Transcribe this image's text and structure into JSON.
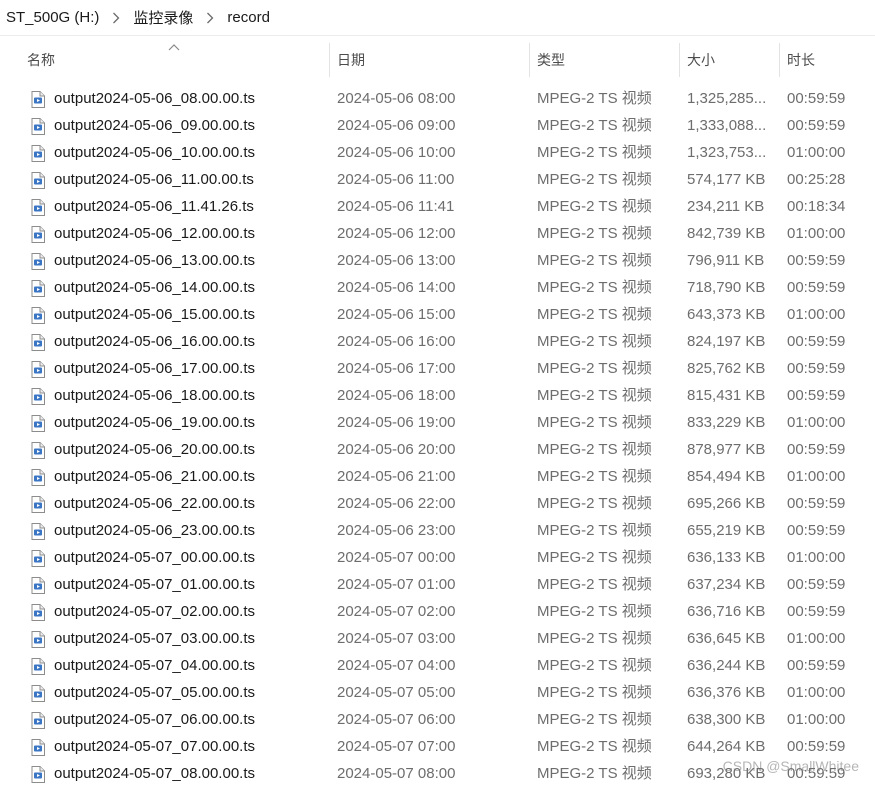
{
  "breadcrumb": [
    "ST_500G (H:)",
    "监控录像",
    "record"
  ],
  "columns": {
    "name": "名称",
    "date": "日期",
    "type": "类型",
    "size": "大小",
    "duration": "时长"
  },
  "files": [
    {
      "name": "output2024-05-06_08.00.00.ts",
      "date": "2024-05-06 08:00",
      "type": "MPEG-2 TS 视频",
      "size": "1,325,285...",
      "duration": "00:59:59"
    },
    {
      "name": "output2024-05-06_09.00.00.ts",
      "date": "2024-05-06 09:00",
      "type": "MPEG-2 TS 视频",
      "size": "1,333,088...",
      "duration": "00:59:59"
    },
    {
      "name": "output2024-05-06_10.00.00.ts",
      "date": "2024-05-06 10:00",
      "type": "MPEG-2 TS 视频",
      "size": "1,323,753...",
      "duration": "01:00:00"
    },
    {
      "name": "output2024-05-06_11.00.00.ts",
      "date": "2024-05-06 11:00",
      "type": "MPEG-2 TS 视频",
      "size": "574,177 KB",
      "duration": "00:25:28"
    },
    {
      "name": "output2024-05-06_11.41.26.ts",
      "date": "2024-05-06 11:41",
      "type": "MPEG-2 TS 视频",
      "size": "234,211 KB",
      "duration": "00:18:34"
    },
    {
      "name": "output2024-05-06_12.00.00.ts",
      "date": "2024-05-06 12:00",
      "type": "MPEG-2 TS 视频",
      "size": "842,739 KB",
      "duration": "01:00:00"
    },
    {
      "name": "output2024-05-06_13.00.00.ts",
      "date": "2024-05-06 13:00",
      "type": "MPEG-2 TS 视频",
      "size": "796,911 KB",
      "duration": "00:59:59"
    },
    {
      "name": "output2024-05-06_14.00.00.ts",
      "date": "2024-05-06 14:00",
      "type": "MPEG-2 TS 视频",
      "size": "718,790 KB",
      "duration": "00:59:59"
    },
    {
      "name": "output2024-05-06_15.00.00.ts",
      "date": "2024-05-06 15:00",
      "type": "MPEG-2 TS 视频",
      "size": "643,373 KB",
      "duration": "01:00:00"
    },
    {
      "name": "output2024-05-06_16.00.00.ts",
      "date": "2024-05-06 16:00",
      "type": "MPEG-2 TS 视频",
      "size": "824,197 KB",
      "duration": "00:59:59"
    },
    {
      "name": "output2024-05-06_17.00.00.ts",
      "date": "2024-05-06 17:00",
      "type": "MPEG-2 TS 视频",
      "size": "825,762 KB",
      "duration": "00:59:59"
    },
    {
      "name": "output2024-05-06_18.00.00.ts",
      "date": "2024-05-06 18:00",
      "type": "MPEG-2 TS 视频",
      "size": "815,431 KB",
      "duration": "00:59:59"
    },
    {
      "name": "output2024-05-06_19.00.00.ts",
      "date": "2024-05-06 19:00",
      "type": "MPEG-2 TS 视频",
      "size": "833,229 KB",
      "duration": "01:00:00"
    },
    {
      "name": "output2024-05-06_20.00.00.ts",
      "date": "2024-05-06 20:00",
      "type": "MPEG-2 TS 视频",
      "size": "878,977 KB",
      "duration": "00:59:59"
    },
    {
      "name": "output2024-05-06_21.00.00.ts",
      "date": "2024-05-06 21:00",
      "type": "MPEG-2 TS 视频",
      "size": "854,494 KB",
      "duration": "01:00:00"
    },
    {
      "name": "output2024-05-06_22.00.00.ts",
      "date": "2024-05-06 22:00",
      "type": "MPEG-2 TS 视频",
      "size": "695,266 KB",
      "duration": "00:59:59"
    },
    {
      "name": "output2024-05-06_23.00.00.ts",
      "date": "2024-05-06 23:00",
      "type": "MPEG-2 TS 视频",
      "size": "655,219 KB",
      "duration": "00:59:59"
    },
    {
      "name": "output2024-05-07_00.00.00.ts",
      "date": "2024-05-07 00:00",
      "type": "MPEG-2 TS 视频",
      "size": "636,133 KB",
      "duration": "01:00:00"
    },
    {
      "name": "output2024-05-07_01.00.00.ts",
      "date": "2024-05-07 01:00",
      "type": "MPEG-2 TS 视频",
      "size": "637,234 KB",
      "duration": "00:59:59"
    },
    {
      "name": "output2024-05-07_02.00.00.ts",
      "date": "2024-05-07 02:00",
      "type": "MPEG-2 TS 视频",
      "size": "636,716 KB",
      "duration": "00:59:59"
    },
    {
      "name": "output2024-05-07_03.00.00.ts",
      "date": "2024-05-07 03:00",
      "type": "MPEG-2 TS 视频",
      "size": "636,645 KB",
      "duration": "01:00:00"
    },
    {
      "name": "output2024-05-07_04.00.00.ts",
      "date": "2024-05-07 04:00",
      "type": "MPEG-2 TS 视频",
      "size": "636,244 KB",
      "duration": "00:59:59"
    },
    {
      "name": "output2024-05-07_05.00.00.ts",
      "date": "2024-05-07 05:00",
      "type": "MPEG-2 TS 视频",
      "size": "636,376 KB",
      "duration": "01:00:00"
    },
    {
      "name": "output2024-05-07_06.00.00.ts",
      "date": "2024-05-07 06:00",
      "type": "MPEG-2 TS 视频",
      "size": "638,300 KB",
      "duration": "01:00:00"
    },
    {
      "name": "output2024-05-07_07.00.00.ts",
      "date": "2024-05-07 07:00",
      "type": "MPEG-2 TS 视频",
      "size": "644,264 KB",
      "duration": "00:59:59"
    },
    {
      "name": "output2024-05-07_08.00.00.ts",
      "date": "2024-05-07 08:00",
      "type": "MPEG-2 TS 视频",
      "size": "693,280 KB",
      "duration": "00:59:59"
    }
  ],
  "watermark": "CSDN @SmallWhitee",
  "icons": {
    "breadcrumb_separator": "chevron-right-icon",
    "sort": "sort-ascending-icon",
    "file": "video-file-icon"
  },
  "colors": {
    "primary_text": "#1a1a1a",
    "secondary_text": "#6d6d6d",
    "header_text": "#4c4c4c",
    "divider": "#e3e3e3"
  }
}
